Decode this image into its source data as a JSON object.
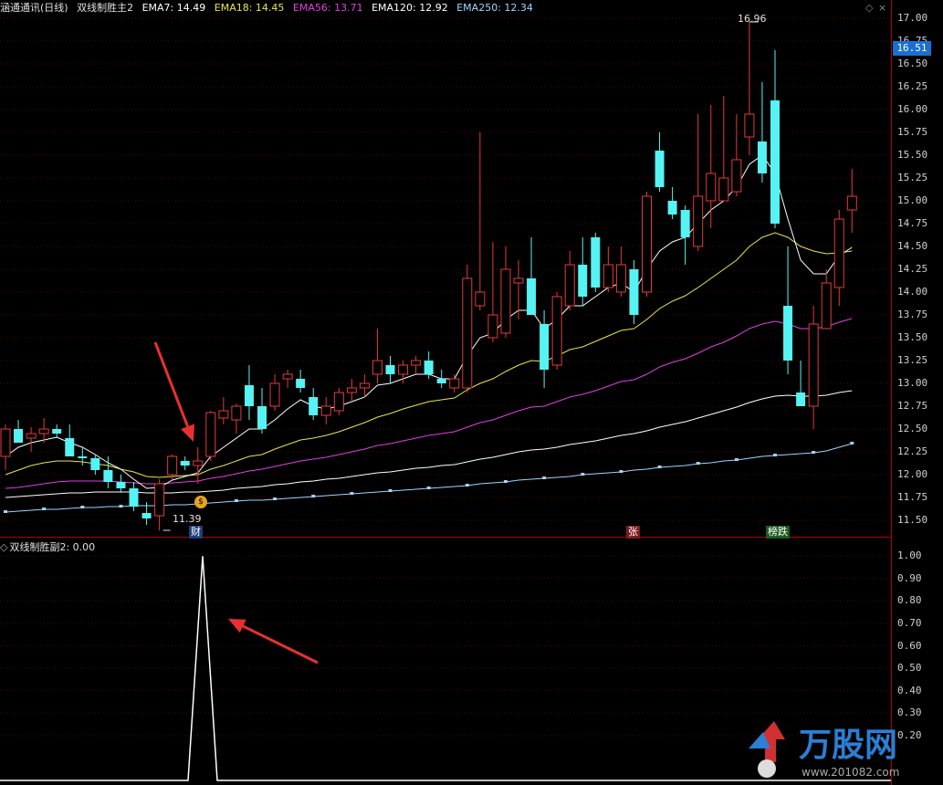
{
  "header_main": {
    "stock_name": "涵通通讯(日线)",
    "indicator": "双线制胜主2",
    "ema7": "EMA7: 14.49",
    "ema18": "EMA18: 14.45",
    "ema56": "EMA56: 13.71",
    "ema120": "EMA120: 12.92",
    "ema250": "EMA250: 12.34"
  },
  "header_sub": {
    "indicator": "双线制胜副2",
    "value": ": 0.00"
  },
  "price_axis": [
    "17.00",
    "16.75",
    "16.50",
    "16.25",
    "16.00",
    "15.75",
    "15.50",
    "15.25",
    "15.00",
    "14.75",
    "14.50",
    "14.25",
    "14.00",
    "13.75",
    "13.50",
    "13.25",
    "13.00",
    "12.75",
    "12.50",
    "12.25",
    "12.00",
    "11.75",
    "11.50"
  ],
  "sub_axis": [
    "1.00",
    "0.90",
    "0.80",
    "0.70",
    "0.60",
    "0.50",
    "0.40",
    "0.30",
    "0.20"
  ],
  "current_price": "16.51",
  "high_label": "16.96",
  "low_label": "11.39",
  "tags": {
    "cai": "财",
    "zhang": "张",
    "bang": "榜跌"
  },
  "controls": {
    "toggle": "◇",
    "close": "×"
  },
  "colors": {
    "up": "#e23b3b",
    "down": "#55f3f3",
    "ema7": "#ffffff",
    "ema18": "#e6e64a",
    "ema56": "#e040e0",
    "ema120": "#ffffff",
    "ema250": "#9fd5ff"
  },
  "chart_data": {
    "type": "candlestick",
    "price_range": [
      11.35,
      17.05
    ],
    "candles": [
      {
        "o": 12.2,
        "h": 12.55,
        "l": 12.05,
        "c": 12.5
      },
      {
        "o": 12.5,
        "h": 12.6,
        "l": 12.35,
        "c": 12.35
      },
      {
        "o": 12.4,
        "h": 12.52,
        "l": 12.25,
        "c": 12.45
      },
      {
        "o": 12.45,
        "h": 12.62,
        "l": 12.35,
        "c": 12.5
      },
      {
        "o": 12.5,
        "h": 12.55,
        "l": 12.4,
        "c": 12.45
      },
      {
        "o": 12.4,
        "h": 12.55,
        "l": 12.2,
        "c": 12.2
      },
      {
        "o": 12.2,
        "h": 12.3,
        "l": 12.1,
        "c": 12.18
      },
      {
        "o": 12.18,
        "h": 12.22,
        "l": 12.0,
        "c": 12.05
      },
      {
        "o": 12.05,
        "h": 12.2,
        "l": 11.85,
        "c": 11.92
      },
      {
        "o": 11.92,
        "h": 12.0,
        "l": 11.8,
        "c": 11.85
      },
      {
        "o": 11.85,
        "h": 11.92,
        "l": 11.6,
        "c": 11.65
      },
      {
        "o": 11.58,
        "h": 11.7,
        "l": 11.45,
        "c": 11.52
      },
      {
        "o": 11.55,
        "h": 11.95,
        "l": 11.39,
        "c": 11.9
      },
      {
        "o": 12.0,
        "h": 12.22,
        "l": 11.95,
        "c": 12.2
      },
      {
        "o": 12.15,
        "h": 12.2,
        "l": 12.05,
        "c": 12.1
      },
      {
        "o": 12.1,
        "h": 12.3,
        "l": 11.9,
        "c": 12.15
      },
      {
        "o": 12.2,
        "h": 12.7,
        "l": 12.15,
        "c": 12.68
      },
      {
        "o": 12.62,
        "h": 12.85,
        "l": 12.55,
        "c": 12.7
      },
      {
        "o": 12.6,
        "h": 12.78,
        "l": 12.45,
        "c": 12.75
      },
      {
        "o": 12.98,
        "h": 13.2,
        "l": 12.6,
        "c": 12.75
      },
      {
        "o": 12.75,
        "h": 12.95,
        "l": 12.45,
        "c": 12.5
      },
      {
        "o": 12.75,
        "h": 13.1,
        "l": 12.7,
        "c": 13.0
      },
      {
        "o": 13.05,
        "h": 13.15,
        "l": 12.95,
        "c": 13.1
      },
      {
        "o": 13.05,
        "h": 13.15,
        "l": 12.9,
        "c": 12.95
      },
      {
        "o": 12.85,
        "h": 12.95,
        "l": 12.6,
        "c": 12.65
      },
      {
        "o": 12.65,
        "h": 12.85,
        "l": 12.55,
        "c": 12.75
      },
      {
        "o": 12.7,
        "h": 12.95,
        "l": 12.65,
        "c": 12.9
      },
      {
        "o": 12.9,
        "h": 13.05,
        "l": 12.8,
        "c": 12.95
      },
      {
        "o": 12.95,
        "h": 13.1,
        "l": 12.85,
        "c": 13.0
      },
      {
        "o": 13.1,
        "h": 13.6,
        "l": 13.0,
        "c": 13.25
      },
      {
        "o": 13.2,
        "h": 13.3,
        "l": 13.0,
        "c": 13.1
      },
      {
        "o": 13.1,
        "h": 13.25,
        "l": 13.0,
        "c": 13.2
      },
      {
        "o": 13.2,
        "h": 13.3,
        "l": 13.1,
        "c": 13.25
      },
      {
        "o": 13.25,
        "h": 13.35,
        "l": 13.05,
        "c": 13.1
      },
      {
        "o": 13.05,
        "h": 13.15,
        "l": 12.95,
        "c": 13.0
      },
      {
        "o": 12.95,
        "h": 13.1,
        "l": 12.9,
        "c": 13.05
      },
      {
        "o": 12.95,
        "h": 14.3,
        "l": 12.9,
        "c": 14.15
      },
      {
        "o": 13.85,
        "h": 15.75,
        "l": 13.8,
        "c": 14.0
      },
      {
        "o": 13.5,
        "h": 14.55,
        "l": 13.45,
        "c": 13.75
      },
      {
        "o": 13.55,
        "h": 14.5,
        "l": 13.5,
        "c": 14.25
      },
      {
        "o": 14.1,
        "h": 14.35,
        "l": 13.7,
        "c": 14.15
      },
      {
        "o": 14.15,
        "h": 14.6,
        "l": 13.8,
        "c": 13.75
      },
      {
        "o": 13.65,
        "h": 13.8,
        "l": 12.95,
        "c": 13.15
      },
      {
        "o": 13.2,
        "h": 14.0,
        "l": 13.15,
        "c": 13.95
      },
      {
        "o": 13.85,
        "h": 14.45,
        "l": 13.8,
        "c": 14.3
      },
      {
        "o": 14.3,
        "h": 14.6,
        "l": 13.85,
        "c": 13.95
      },
      {
        "o": 14.6,
        "h": 14.65,
        "l": 14.0,
        "c": 14.05
      },
      {
        "o": 14.05,
        "h": 14.5,
        "l": 14.0,
        "c": 14.3
      },
      {
        "o": 14.0,
        "h": 14.5,
        "l": 13.95,
        "c": 14.3
      },
      {
        "o": 14.25,
        "h": 14.35,
        "l": 13.65,
        "c": 13.75
      },
      {
        "o": 14.0,
        "h": 15.1,
        "l": 13.95,
        "c": 15.05
      },
      {
        "o": 15.55,
        "h": 15.75,
        "l": 15.1,
        "c": 15.15
      },
      {
        "o": 15.0,
        "h": 15.15,
        "l": 14.8,
        "c": 14.85
      },
      {
        "o": 14.9,
        "h": 14.95,
        "l": 14.3,
        "c": 14.6
      },
      {
        "o": 14.5,
        "h": 15.95,
        "l": 14.45,
        "c": 15.05
      },
      {
        "o": 15.0,
        "h": 16.05,
        "l": 14.7,
        "c": 15.3
      },
      {
        "o": 15.0,
        "h": 16.15,
        "l": 15.0,
        "c": 15.25
      },
      {
        "o": 15.1,
        "h": 15.95,
        "l": 15.05,
        "c": 15.45
      },
      {
        "o": 15.7,
        "h": 16.96,
        "l": 15.5,
        "c": 15.95
      },
      {
        "o": 15.65,
        "h": 16.3,
        "l": 15.2,
        "c": 15.3
      },
      {
        "o": 16.1,
        "h": 16.65,
        "l": 14.7,
        "c": 14.75
      },
      {
        "o": 13.85,
        "h": 14.5,
        "l": 13.1,
        "c": 13.25
      },
      {
        "o": 12.9,
        "h": 13.25,
        "l": 12.75,
        "c": 12.75
      },
      {
        "o": 12.75,
        "h": 13.85,
        "l": 12.5,
        "c": 13.65
      },
      {
        "o": 13.6,
        "h": 14.25,
        "l": 13.6,
        "c": 14.1
      },
      {
        "o": 14.05,
        "h": 14.9,
        "l": 13.85,
        "c": 14.8
      },
      {
        "o": 14.9,
        "h": 15.35,
        "l": 14.65,
        "c": 15.05
      }
    ],
    "ema7": [
      12.2,
      12.3,
      12.35,
      12.38,
      12.41,
      12.35,
      12.3,
      12.22,
      12.13,
      12.06,
      11.95,
      11.85,
      11.86,
      11.94,
      11.98,
      12.02,
      12.2,
      12.3,
      12.4,
      12.5,
      12.5,
      12.6,
      12.72,
      12.82,
      12.75,
      12.72,
      12.75,
      12.8,
      12.85,
      12.98,
      13.0,
      13.05,
      13.1,
      13.1,
      13.05,
      13.05,
      13.3,
      13.5,
      13.55,
      13.7,
      13.8,
      13.8,
      13.6,
      13.7,
      13.85,
      13.85,
      13.95,
      14.05,
      14.1,
      14.0,
      14.25,
      14.45,
      14.55,
      14.6,
      14.75,
      14.9,
      15.0,
      15.15,
      15.4,
      15.5,
      15.3,
      14.8,
      14.35,
      14.2,
      14.2,
      14.4,
      14.49
    ],
    "ema18": [
      12.0,
      12.05,
      12.1,
      12.13,
      12.15,
      12.15,
      12.14,
      12.12,
      12.1,
      12.06,
      12.03,
      11.98,
      11.97,
      11.98,
      11.99,
      12.0,
      12.06,
      12.1,
      12.15,
      12.2,
      12.22,
      12.28,
      12.33,
      12.38,
      12.4,
      12.43,
      12.47,
      12.52,
      12.57,
      12.63,
      12.67,
      12.72,
      12.76,
      12.8,
      12.82,
      12.84,
      12.93,
      13.0,
      13.05,
      13.13,
      13.2,
      13.25,
      13.24,
      13.3,
      13.37,
      13.4,
      13.46,
      13.52,
      13.58,
      13.6,
      13.7,
      13.82,
      13.9,
      13.96,
      14.05,
      14.15,
      14.25,
      14.35,
      14.5,
      14.6,
      14.65,
      14.6,
      14.5,
      14.45,
      14.42,
      14.43,
      14.45
    ],
    "ema56": [
      11.85,
      11.86,
      11.88,
      11.9,
      11.92,
      11.93,
      11.93,
      11.93,
      11.93,
      11.92,
      11.91,
      11.9,
      11.9,
      11.91,
      11.92,
      11.93,
      11.96,
      11.98,
      12.01,
      12.04,
      12.06,
      12.09,
      12.12,
      12.15,
      12.17,
      12.19,
      12.22,
      12.25,
      12.28,
      12.32,
      12.34,
      12.37,
      12.4,
      12.43,
      12.45,
      12.47,
      12.52,
      12.57,
      12.6,
      12.65,
      12.7,
      12.74,
      12.75,
      12.8,
      12.85,
      12.88,
      12.92,
      12.97,
      13.02,
      13.04,
      13.1,
      13.18,
      13.23,
      13.27,
      13.33,
      13.4,
      13.45,
      13.52,
      13.6,
      13.65,
      13.68,
      13.65,
      13.6,
      13.6,
      13.62,
      13.67,
      13.71
    ],
    "ema120": [
      11.75,
      11.76,
      11.77,
      11.78,
      11.79,
      11.8,
      11.8,
      11.81,
      11.81,
      11.81,
      11.81,
      11.8,
      11.8,
      11.8,
      11.81,
      11.81,
      11.82,
      11.83,
      11.85,
      11.86,
      11.87,
      11.89,
      11.9,
      11.92,
      11.93,
      11.95,
      11.96,
      11.98,
      12.0,
      12.02,
      12.03,
      12.05,
      12.07,
      12.08,
      12.1,
      12.11,
      12.14,
      12.17,
      12.19,
      12.22,
      12.25,
      12.27,
      12.28,
      12.3,
      12.33,
      12.35,
      12.37,
      12.4,
      12.43,
      12.45,
      12.48,
      12.52,
      12.55,
      12.58,
      12.62,
      12.66,
      12.7,
      12.74,
      12.79,
      12.83,
      12.86,
      12.87,
      12.86,
      12.86,
      12.87,
      12.9,
      12.92
    ],
    "ema250": [
      11.59,
      11.6,
      11.61,
      11.62,
      11.62,
      11.63,
      11.64,
      11.64,
      11.65,
      11.65,
      11.66,
      11.66,
      11.66,
      11.67,
      11.67,
      11.68,
      11.69,
      11.7,
      11.71,
      11.72,
      11.72,
      11.73,
      11.74,
      11.75,
      11.76,
      11.77,
      11.78,
      11.79,
      11.8,
      11.81,
      11.82,
      11.83,
      11.84,
      11.85,
      11.86,
      11.87,
      11.88,
      11.9,
      11.91,
      11.92,
      11.94,
      11.95,
      11.96,
      11.97,
      11.98,
      12.0,
      12.01,
      12.02,
      12.03,
      12.05,
      12.06,
      12.08,
      12.09,
      12.1,
      12.12,
      12.13,
      12.15,
      12.16,
      12.18,
      12.2,
      12.21,
      12.22,
      12.23,
      12.24,
      12.26,
      12.3,
      12.34
    ],
    "sub_series": [
      0,
      0,
      0,
      0,
      0,
      0,
      0,
      0,
      0,
      0,
      0,
      0,
      0,
      0,
      1,
      0,
      0,
      0,
      0,
      0,
      0,
      0,
      0,
      0,
      0,
      0,
      0,
      0,
      0,
      0,
      0,
      0,
      0,
      0,
      0,
      0,
      0,
      0,
      0,
      0,
      0,
      0,
      0,
      0,
      0,
      0,
      0,
      0,
      0,
      0,
      0,
      0,
      0,
      0,
      0,
      0,
      0,
      0,
      0,
      0,
      0,
      0,
      0,
      0,
      0,
      0,
      0
    ],
    "sub_range": [
      0.0,
      1.05
    ]
  }
}
